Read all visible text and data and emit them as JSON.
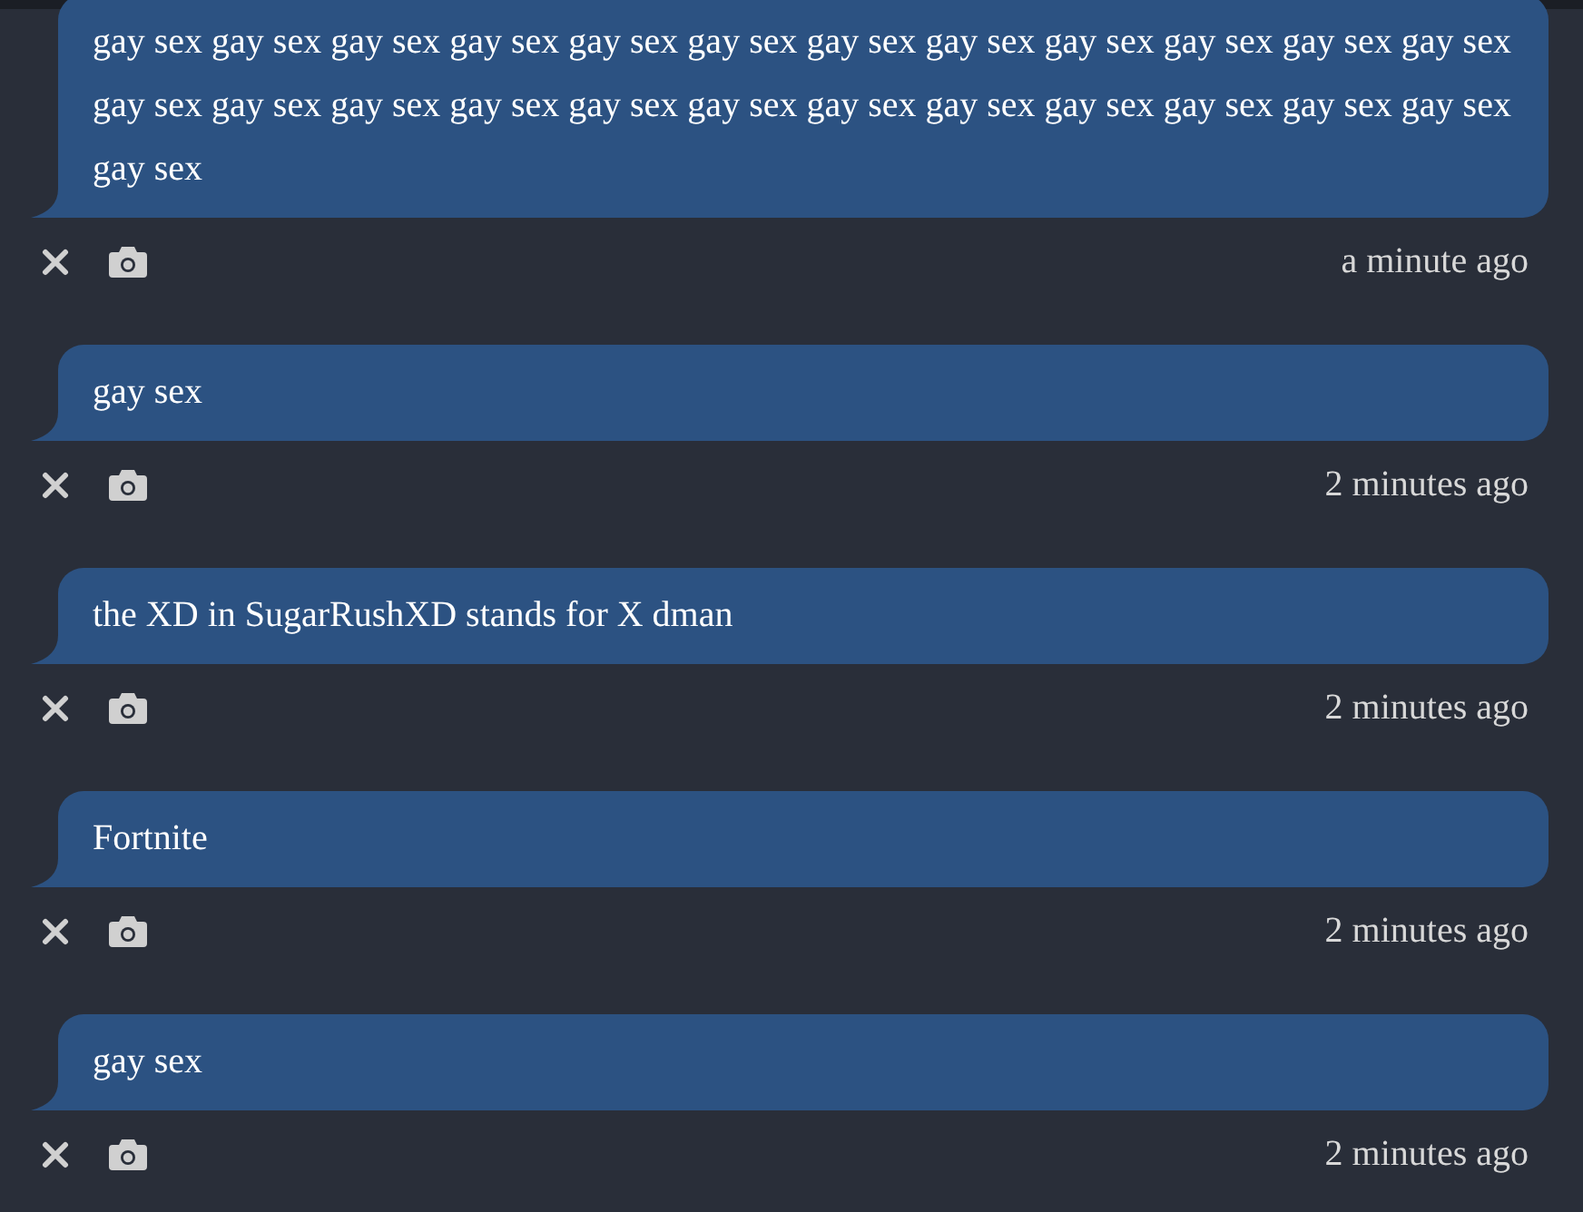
{
  "messages": [
    {
      "text": "gay sex gay sex gay sex gay sex gay sex gay sex gay sex gay sex gay sex gay sex gay sex gay sex gay sex gay sex gay sex gay sex gay sex gay sex gay sex gay sex gay sex gay sex gay sex gay sex gay sex",
      "time": "a minute ago"
    },
    {
      "text": "gay sex",
      "time": "2 minutes ago"
    },
    {
      "text": "the XD in SugarRushXD stands for X dman",
      "time": "2 minutes ago"
    },
    {
      "text": "Fortnite",
      "time": "2 minutes ago"
    },
    {
      "text": "gay sex",
      "time": "2 minutes ago"
    }
  ]
}
